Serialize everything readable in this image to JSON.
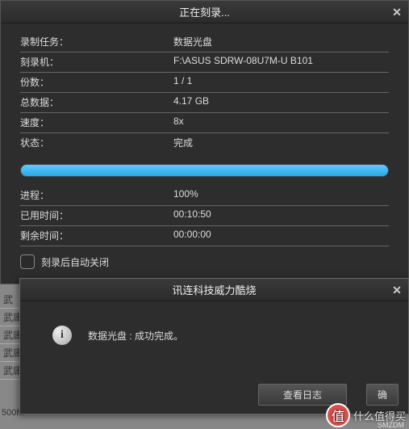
{
  "main": {
    "title": "正在刻录...",
    "rows": {
      "task_label": "录制任务：",
      "task_value": "数据光盘",
      "recorder_label": "刻录机：",
      "recorder_value": "F:\\ASUS SDRW-08U7M-U B101",
      "copies_label": "份数：",
      "copies_value": "1 / 1",
      "total_label": "总数据：",
      "total_value": "4.17 GB",
      "speed_label": "速度：",
      "speed_value": "8x",
      "status_label": "状态：",
      "status_value": "完成",
      "progress_label": "进程：",
      "progress_value": "100%",
      "elapsed_label": "已用时间：",
      "elapsed_value": "00:10:50",
      "remain_label": "剩余时间：",
      "remain_value": "00:00:00"
    },
    "checkbox_label": "刻录后自动关闭"
  },
  "sub": {
    "title": "讯连科技威力酷烧",
    "message": "数据光盘 : 成功完成。",
    "btn_log": "查看日志",
    "btn_ok_partial": "确"
  },
  "bg": {
    "r1": "武",
    "r2": "武庸",
    "r3": "武庸",
    "r4": "武庸",
    "r5": "武庸",
    "footer": "500M"
  },
  "watermark": {
    "badge": "值",
    "text": "什么值得买",
    "sub": "SMZDM"
  }
}
